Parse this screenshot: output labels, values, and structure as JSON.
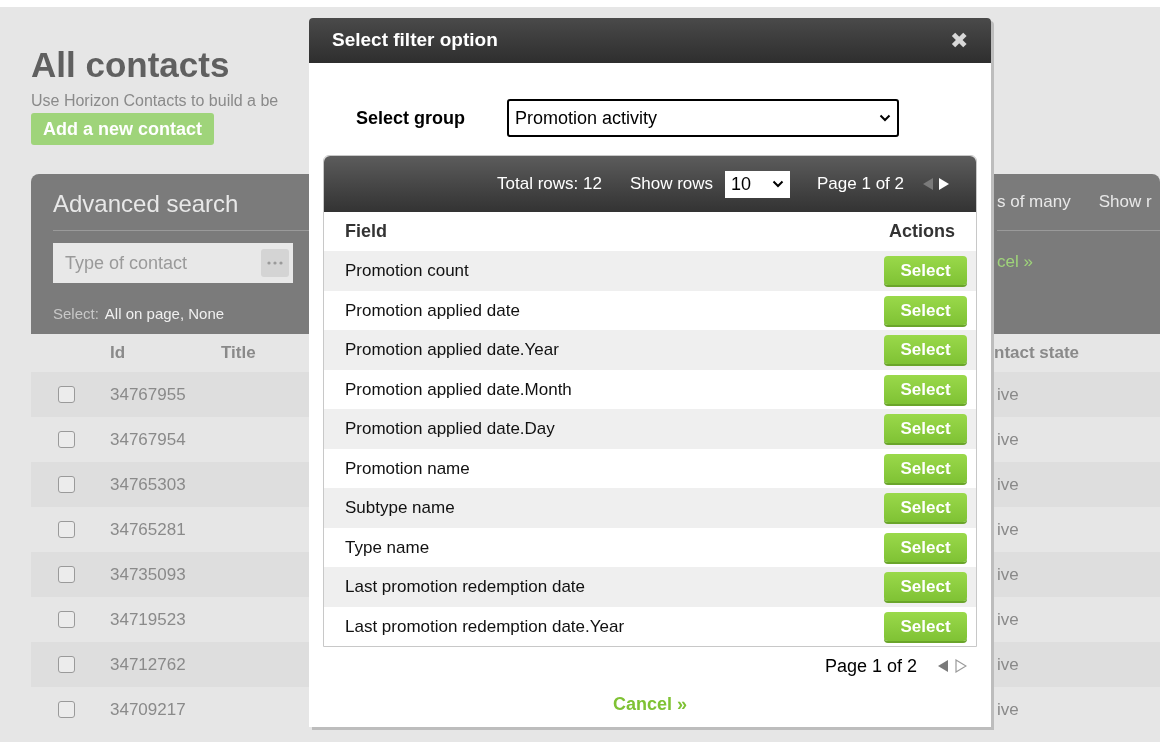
{
  "page": {
    "title": "All contacts",
    "description": "Use Horizon Contacts to build a be",
    "add_button": "Add a new contact"
  },
  "search_panel": {
    "title": "Advanced search",
    "header_fragments": [
      "s of many",
      "Show r"
    ],
    "type_field": {
      "placeholder": "Type of contact"
    },
    "link_fragment": "cel »",
    "select_label": "Select:",
    "select_links": "All on page, None"
  },
  "contacts_table": {
    "columns": [
      "Id",
      "Title",
      "ntact state"
    ],
    "rows": [
      {
        "id": "34767955",
        "checked": false,
        "state": "ive"
      },
      {
        "id": "34767954",
        "checked": false,
        "state": "ive"
      },
      {
        "id": "34765303",
        "checked": false,
        "state": "ive"
      },
      {
        "id": "34765281",
        "checked": false,
        "state": "ive"
      },
      {
        "id": "34735093",
        "checked": false,
        "state": "ive"
      },
      {
        "id": "34719523",
        "checked": false,
        "state": "ive"
      },
      {
        "id": "34712762",
        "checked": false,
        "state": "ive"
      },
      {
        "id": "34709217",
        "checked": false,
        "state": "ive"
      }
    ]
  },
  "dialog": {
    "title": "Select filter option",
    "close": "✖",
    "group_label": "Select group",
    "group_value": "Promotion activity",
    "toolbar": {
      "total_rows": "Total rows: 12",
      "show_rows_label": "Show rows",
      "show_rows_value": "10",
      "page": "Page 1 of 2"
    },
    "columns": [
      "Field",
      "Actions"
    ],
    "rows": [
      {
        "field": "Promotion count",
        "action": "Select"
      },
      {
        "field": "Promotion applied date",
        "action": "Select"
      },
      {
        "field": "Promotion applied date.Year",
        "action": "Select"
      },
      {
        "field": "Promotion applied date.Month",
        "action": "Select"
      },
      {
        "field": "Promotion applied date.Day",
        "action": "Select"
      },
      {
        "field": "Promotion name",
        "action": "Select"
      },
      {
        "field": "Subtype name",
        "action": "Select"
      },
      {
        "field": "Type name",
        "action": "Select"
      },
      {
        "field": "Last promotion redemption date",
        "action": "Select"
      },
      {
        "field": "Last promotion redemption date.Year",
        "action": "Select"
      }
    ],
    "footer_page": "Page 1 of 2",
    "cancel": "Cancel »"
  }
}
